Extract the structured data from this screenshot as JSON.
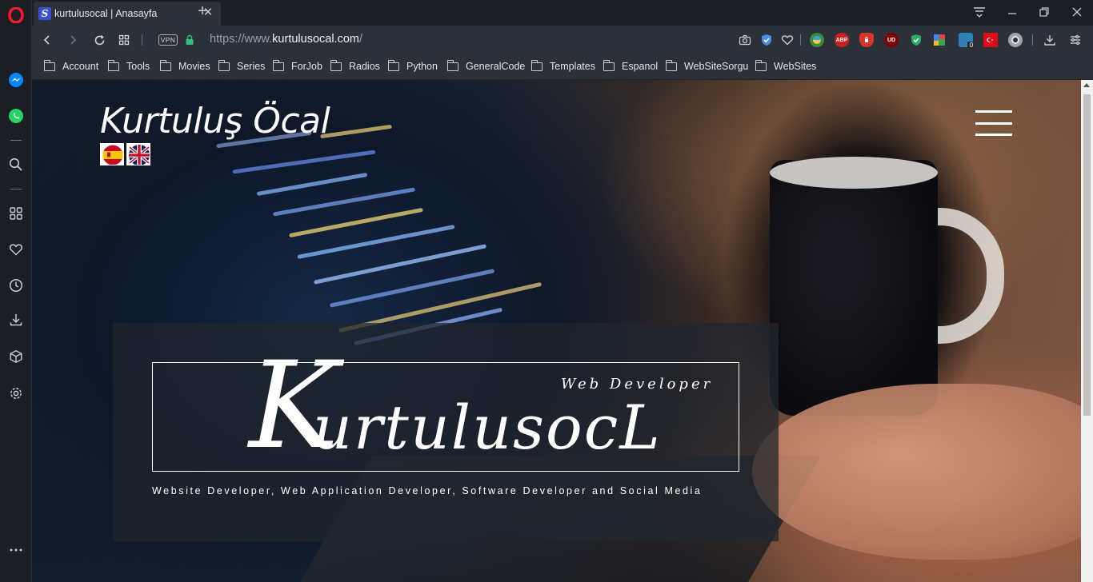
{
  "browser": {
    "tab": {
      "title": "kurtulusocal | Anasayfa",
      "favicon_letter": "S"
    },
    "address": {
      "vpn_label": "VPN",
      "url_prefix": "https://www.",
      "url_domain": "kurtulusocal.com",
      "url_suffix": "/"
    },
    "extensions": {
      "abp": "ABP",
      "ud": "UD",
      "badge_count": "0"
    },
    "bookmarks": [
      {
        "label": "Account"
      },
      {
        "label": "Tools"
      },
      {
        "label": "Movies"
      },
      {
        "label": "Series"
      },
      {
        "label": "ForJob"
      },
      {
        "label": "Radios"
      },
      {
        "label": "Python"
      },
      {
        "label": "GeneralCode"
      },
      {
        "label": "Templates"
      },
      {
        "label": "Espanol"
      },
      {
        "label": "WebSiteSorgu"
      },
      {
        "label": "WebSites"
      }
    ],
    "sidebar_icons": [
      "opera-logo-icon",
      "messenger-icon",
      "whatsapp-icon",
      "search-icon",
      "speed-dial-icon",
      "heart-icon",
      "history-icon",
      "download-icon",
      "cube-icon",
      "settings-icon",
      "more-icon"
    ]
  },
  "page": {
    "site_name": "Kurtuluş Öcal",
    "languages": [
      "es",
      "en"
    ],
    "hero": {
      "tagline_small": "Web Developer",
      "logo_initial": "K",
      "logo_rest": "urtulusocL",
      "subtitle": "Website Developer, Web Application Developer, Software Developer and Social Media"
    }
  },
  "colors": {
    "chrome_bg": "#1b1e24",
    "toolbar_bg": "#2b3039",
    "opera_red": "#ff1b2d",
    "hero_box": "rgba(32,38,46,0.75)"
  }
}
